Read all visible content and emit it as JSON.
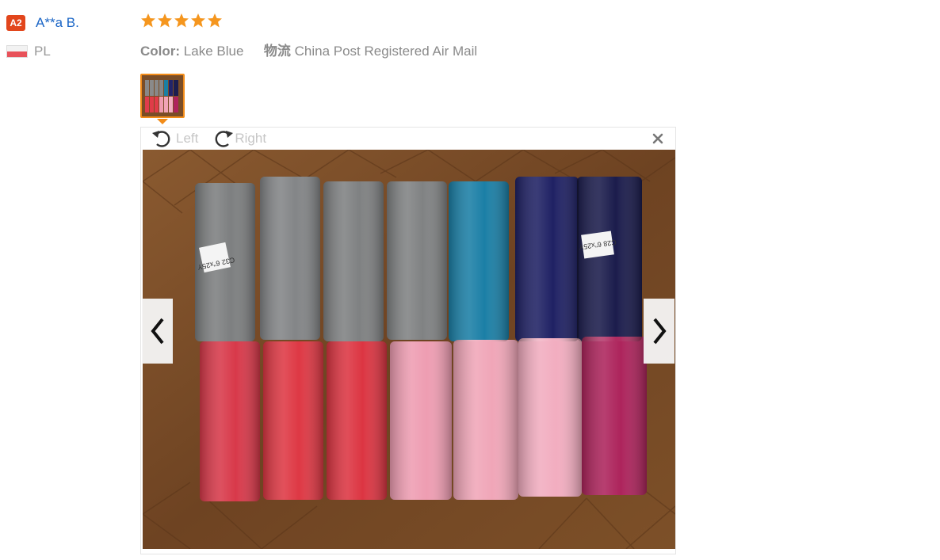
{
  "user": {
    "level": "A2",
    "name": "A**a B.",
    "country": "PL"
  },
  "review": {
    "rating": 5,
    "color_label": "Color:",
    "color_value": "Lake Blue",
    "shipping_label": "物流",
    "shipping_value": "China Post Registered Air Mail"
  },
  "viewer": {
    "rotate_left": "Left",
    "rotate_right": "Right",
    "photo_labels": [
      "C32 6\"x25Y",
      "C28 6\"x25Y"
    ]
  },
  "colors": {
    "accent": "#f28c19",
    "star": "#f5961e",
    "link": "#1a65c6",
    "badge": "#e2461c"
  }
}
